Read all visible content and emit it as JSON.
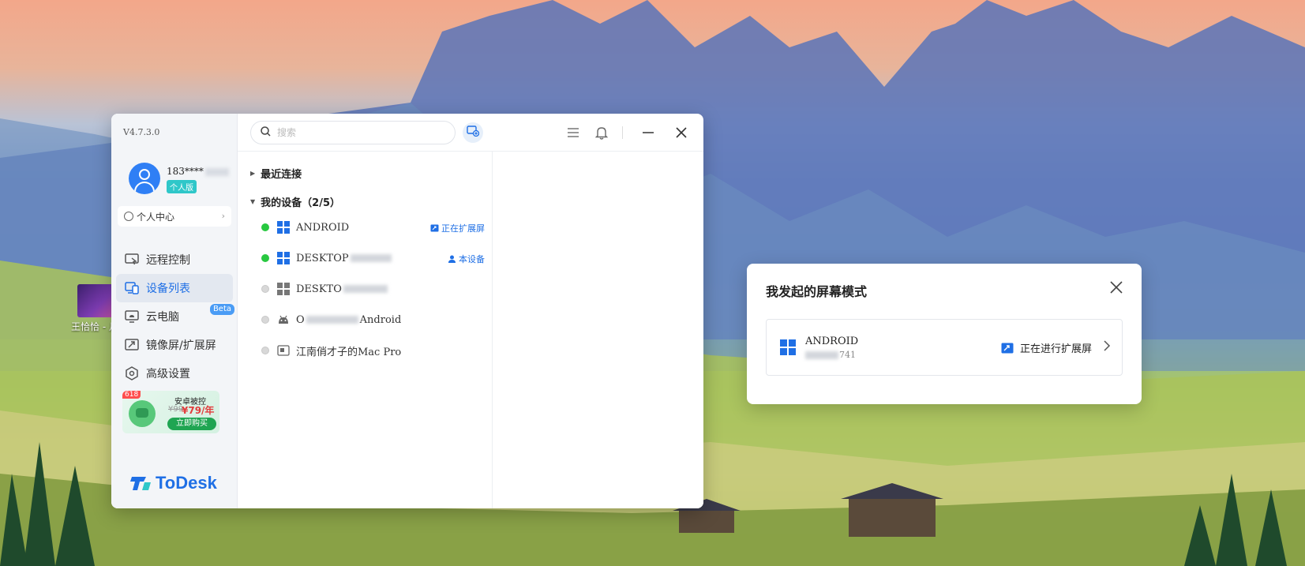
{
  "desktop": {
    "icon_label": "王恰恰 - 月里的小"
  },
  "app": {
    "version": "V4.7.3.0",
    "user": {
      "name": "183****",
      "plan": "个人版"
    },
    "profile_label": "个人中心",
    "nav": [
      {
        "label": "远程控制",
        "icon": "monitor-remote-icon",
        "active": false
      },
      {
        "label": "设备列表",
        "icon": "devices-icon",
        "active": true
      },
      {
        "label": "云电脑",
        "icon": "cloud-pc-icon",
        "active": false,
        "badge": "Beta"
      },
      {
        "label": "镜像屏/扩展屏",
        "icon": "mirror-screen-icon",
        "active": false
      },
      {
        "label": "高级设置",
        "icon": "settings-icon",
        "active": false
      }
    ],
    "promo": {
      "tag": "618",
      "title": "安卓被控",
      "old_price": "¥99",
      "new_price": "¥79/年",
      "cta": "立即购买"
    },
    "logo_text": "ToDesk",
    "search": {
      "placeholder": "搜索"
    },
    "groups": {
      "recent": "最近连接",
      "mine": "我的设备（2/5）"
    },
    "devices": [
      {
        "name": "ANDROID",
        "online": true,
        "os": "windows",
        "status": "正在扩展屏"
      },
      {
        "name": "DESKTOP",
        "online": true,
        "os": "windows",
        "status": "本设备"
      },
      {
        "name": "DESKTO",
        "online": false,
        "os": "windows",
        "status": ""
      },
      {
        "name_prefix": "O",
        "name_suffix": "Android",
        "online": false,
        "os": "android",
        "status": ""
      },
      {
        "name": "江南俏才子的Mac Pro",
        "online": false,
        "os": "mac",
        "status": ""
      }
    ],
    "colors": {
      "accent": "#1f6fe5",
      "online": "#28c840",
      "offline": "#d8d8d8"
    }
  },
  "popup": {
    "title": "我发起的屏幕模式",
    "card": {
      "name": "ANDROID",
      "id_suffix": "741",
      "status": "正在进行扩展屏"
    }
  }
}
